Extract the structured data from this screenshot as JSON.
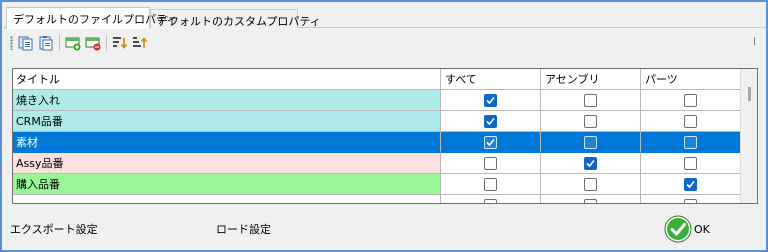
{
  "tabs": [
    {
      "label": "デフォルトのファイルプロパティ",
      "active": true
    },
    {
      "label": "デフォルトのカスタムプロパティ",
      "active": false
    }
  ],
  "toolbar": {
    "icons": [
      "copy-props-icon",
      "paste-props-icon",
      "add-row-icon",
      "delete-row-icon",
      "sort-down-icon",
      "sort-up-icon"
    ]
  },
  "grid": {
    "columns": [
      "タイトル",
      "すべて",
      "アセンブリ",
      "パーツ"
    ],
    "rows": [
      {
        "title": "焼き入れ",
        "all": true,
        "assembly": false,
        "part": false,
        "color": "#aeeaea"
      },
      {
        "title": "CRM品番",
        "all": true,
        "assembly": false,
        "part": false,
        "color": "#aeeaea"
      },
      {
        "title": "素材",
        "all": true,
        "assembly": false,
        "part": false,
        "color": "#0078d7",
        "selected": true
      },
      {
        "title": "Assy品番",
        "all": false,
        "assembly": true,
        "part": false,
        "color": "#fde0e0"
      },
      {
        "title": "購入品番",
        "all": false,
        "assembly": false,
        "part": true,
        "color": "#98f898"
      },
      {
        "title": "",
        "all": false,
        "assembly": false,
        "part": false,
        "color": "#ffffff"
      }
    ]
  },
  "footer": {
    "export_label": "エクスポート設定",
    "load_label": "ロード設定",
    "ok_label": "OK"
  }
}
